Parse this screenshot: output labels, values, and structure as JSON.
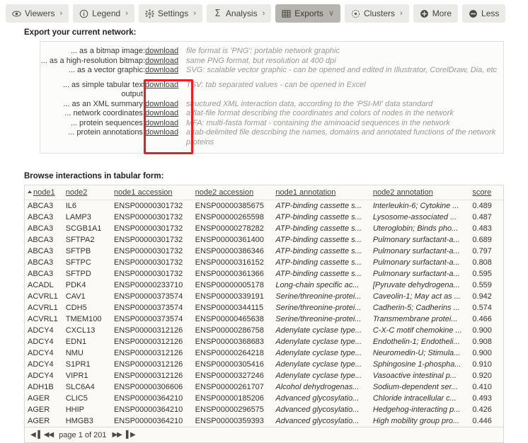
{
  "toolbar": {
    "buttons": [
      {
        "label": "Viewers",
        "icon": "eye-icon",
        "chevron": "›",
        "active": false
      },
      {
        "label": "Legend",
        "icon": "info-icon",
        "chevron": "›",
        "active": false
      },
      {
        "label": "Settings",
        "icon": "gear-icon",
        "chevron": "›",
        "active": false
      },
      {
        "label": "Analysis",
        "icon": "sigma-icon",
        "chevron": "›",
        "active": false
      },
      {
        "label": "Exports",
        "icon": "grid-icon",
        "chevron": "∨",
        "active": true
      },
      {
        "label": "Clusters",
        "icon": "clusters-icon",
        "chevron": "›",
        "active": false
      },
      {
        "label": "More",
        "icon": "plus-circle-icon",
        "chevron": "",
        "active": false
      },
      {
        "label": "Less",
        "icon": "minus-circle-icon",
        "chevron": "",
        "active": false
      }
    ]
  },
  "export": {
    "title": "Export your current network:",
    "link_label": "download",
    "highlight_color": "#ee1c23",
    "rows": [
      {
        "label": "... as a bitmap image:",
        "desc": "file format is 'PNG': portable network graphic"
      },
      {
        "label": "... as a high-resolution bitmap:",
        "desc": "same PNG format, but resolution at 400 dpi"
      },
      {
        "label": "... as a vector graphic:",
        "desc": "SVG: scalable vector graphic - can be opened and edited in Illustrator, CorelDraw, Dia, etc"
      },
      {
        "label": "... as simple tabular text output:",
        "desc": "TSV: tab separated values - can be opened in Excel"
      },
      {
        "label": "... as an XML summary:",
        "desc": "structured XML interaction data, according to the 'PSI-MI' data standard"
      },
      {
        "label": "... network coordinates:",
        "desc": "a flat-file format describing the coordinates and colors of nodes in the network"
      },
      {
        "label": "... protein sequences:",
        "desc": "MFA: multi-fasta format - containing the aminoacid sequences in the network"
      },
      {
        "label": "... protein annotations:",
        "desc": "a tab-delimited file describing the names, domains and annotated functions of the network proteins"
      }
    ]
  },
  "browse": {
    "title": "Browse interactions in tabular form:",
    "columns": [
      "node1",
      "node2",
      "node1 accession",
      "node2 accession",
      "node1 annotation",
      "node2 annotation",
      "score"
    ],
    "sorted_column": "node1",
    "sort_direction": "asc",
    "rows": [
      [
        "ABCA3",
        "IL6",
        "ENSP00000301732",
        "ENSP00000385675",
        "ATP-binding cassette s...",
        "Interleukin-6; Cytokine ...",
        "0.489"
      ],
      [
        "ABCA3",
        "LAMP3",
        "ENSP00000301732",
        "ENSP00000265598",
        "ATP-binding cassette s...",
        "Lysosome-associated ...",
        "0.487"
      ],
      [
        "ABCA3",
        "SCGB1A1",
        "ENSP00000301732",
        "ENSP00000278282",
        "ATP-binding cassette s...",
        "Uteroglobin; Binds pho...",
        "0.483"
      ],
      [
        "ABCA3",
        "SFTPA2",
        "ENSP00000301732",
        "ENSP00000361400",
        "ATP-binding cassette s...",
        "Pulmonary surfactant-a...",
        "0.689"
      ],
      [
        "ABCA3",
        "SFTPB",
        "ENSP00000301732",
        "ENSP00000386346",
        "ATP-binding cassette s...",
        "Pulmonary surfactant-a...",
        "0.797"
      ],
      [
        "ABCA3",
        "SFTPC",
        "ENSP00000301732",
        "ENSP00000316152",
        "ATP-binding cassette s...",
        "Pulmonary surfactant-a...",
        "0.808"
      ],
      [
        "ABCA3",
        "SFTPD",
        "ENSP00000301732",
        "ENSP00000361366",
        "ATP-binding cassette s...",
        "Pulmonary surfactant-a...",
        "0.595"
      ],
      [
        "ACADL",
        "PDK4",
        "ENSP00000233710",
        "ENSP00000005178",
        "Long-chain specific ac...",
        "[Pyruvate dehydrogena...",
        "0.559"
      ],
      [
        "ACVRL1",
        "CAV1",
        "ENSP00000373574",
        "ENSP00000339191",
        "Serine/threonine-protei...",
        "Caveolin-1; May act as ...",
        "0.942"
      ],
      [
        "ACVRL1",
        "CDH5",
        "ENSP00000373574",
        "ENSP00000344115",
        "Serine/threonine-protei...",
        "Cadherin-5; Cadherins ...",
        "0.574"
      ],
      [
        "ACVRL1",
        "TMEM100",
        "ENSP00000373574",
        "ENSP00000465638",
        "Serine/threonine-protei...",
        "Transmembrane protei...",
        "0.466"
      ],
      [
        "ADCY4",
        "CXCL13",
        "ENSP00000312126",
        "ENSP00000286758",
        "Adenylate cyclase type...",
        "C-X-C motif chemokine ...",
        "0.900"
      ],
      [
        "ADCY4",
        "EDN1",
        "ENSP00000312126",
        "ENSP00000368683",
        "Adenylate cyclase type...",
        "Endothelin-1; Endotheli...",
        "0.908"
      ],
      [
        "ADCY4",
        "NMU",
        "ENSP00000312126",
        "ENSP00000264218",
        "Adenylate cyclase type...",
        "Neuromedin-U; Stimula...",
        "0.900"
      ],
      [
        "ADCY4",
        "S1PR1",
        "ENSP00000312126",
        "ENSP00000305416",
        "Adenylate cyclase type...",
        "Sphingosine 1-phospha...",
        "0.910"
      ],
      [
        "ADCY4",
        "VIPR1",
        "ENSP00000312126",
        "ENSP00000327246",
        "Adenylate cyclase type...",
        "Vasoactive intestinal p...",
        "0.920"
      ],
      [
        "ADH1B",
        "SLC6A4",
        "ENSP00000306606",
        "ENSP00000261707",
        "Alcohol dehydrogenas...",
        "Sodium-dependent ser...",
        "0.410"
      ],
      [
        "AGER",
        "CLIC5",
        "ENSP00000364210",
        "ENSP00000185206",
        "Advanced glycosylatio...",
        "Chloride intracellular c...",
        "0.493"
      ],
      [
        "AGER",
        "HHIP",
        "ENSP00000364210",
        "ENSP00000296575",
        "Advanced glycosylatio...",
        "Hedgehog-interacting p...",
        "0.426"
      ],
      [
        "AGER",
        "HMGB3",
        "ENSP00000364210",
        "ENSP00000359393",
        "Advanced glycosylatio...",
        "High mobility group pro...",
        "0.446"
      ]
    ]
  },
  "pager": {
    "first_icon": "◀▐",
    "prev_icon": "◀◀",
    "text": "page 1 of 201",
    "next_icon": "▶▶",
    "last_icon": "▌▶",
    "current_page": 1,
    "total_pages": 201
  }
}
